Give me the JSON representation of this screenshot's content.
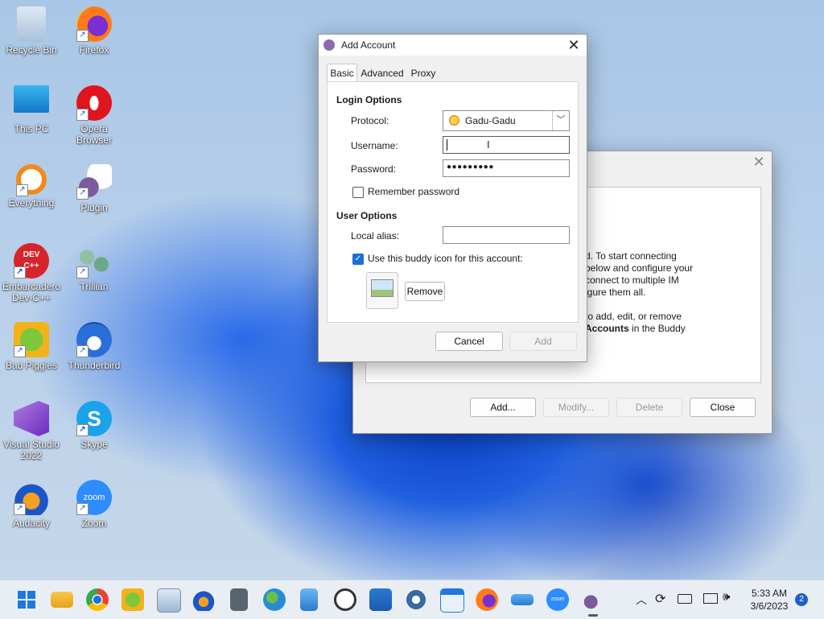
{
  "desktop": {
    "icons": [
      {
        "label": "Recycle Bin"
      },
      {
        "label": "Firefox"
      },
      {
        "label": "This PC"
      },
      {
        "label": "Opera Browser"
      },
      {
        "label": "Everything"
      },
      {
        "label": "Pidgin"
      },
      {
        "label": "Embarcadero Dev-C++"
      },
      {
        "label": "Trillian"
      },
      {
        "label": "Bad Piggies"
      },
      {
        "label": "Thunderbird"
      },
      {
        "label": "Visual Studio 2022"
      },
      {
        "label": "Skype"
      },
      {
        "label": "Audacity"
      },
      {
        "label": "Zoom"
      }
    ]
  },
  "back_window": {
    "text_lines": [
      "d. To start connecting",
      "below and configure your",
      "connect to multiple IM",
      "igure them all.",
      "to add, edit, or remove"
    ],
    "last_line_bold": "Accounts",
    "last_line_rest": " in the Buddy",
    "buttons": {
      "add": "Add...",
      "modify": "Modify...",
      "delete": "Delete",
      "close": "Close"
    }
  },
  "dialog": {
    "title": "Add Account",
    "tabs": [
      "Basic",
      "Advanced",
      "Proxy"
    ],
    "login_options_header": "Login Options",
    "protocol_label": "Protocol:",
    "protocol_value": "Gadu-Gadu",
    "username_label": "Username:",
    "username_value": "",
    "password_label": "Password:",
    "password_value": "●●●●●●●●●",
    "remember_password_label": "Remember password",
    "user_options_header": "User Options",
    "local_alias_label": "Local alias:",
    "local_alias_value": "",
    "buddy_icon_label": "Use this buddy icon for this account:",
    "remove_label": "Remove",
    "cancel_label": "Cancel",
    "add_label": "Add"
  },
  "taskbar": {
    "time": "5:33 AM",
    "date": "3/6/2023",
    "notification_count": "2"
  },
  "colors": {
    "accent": "#1a6fd8",
    "taskbar": "#e9eef5"
  }
}
